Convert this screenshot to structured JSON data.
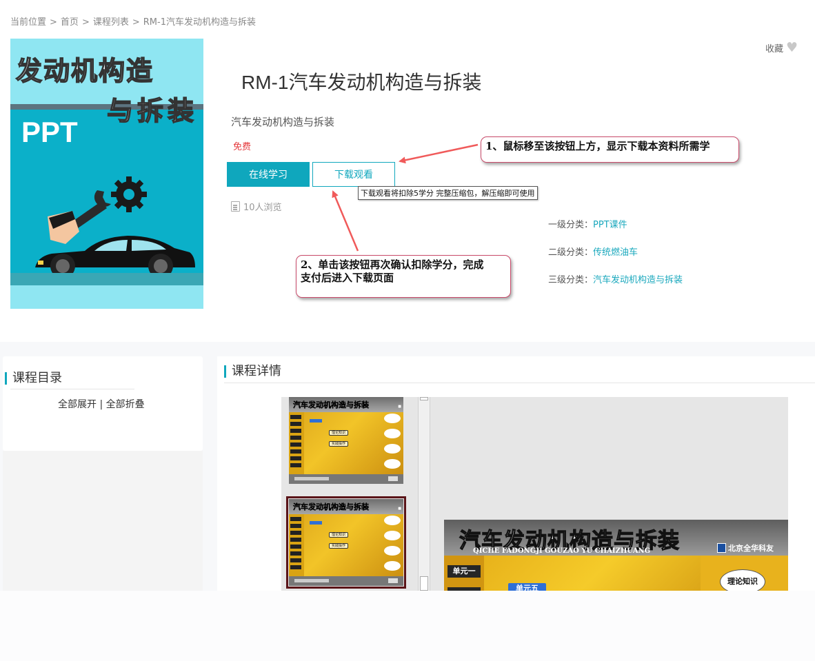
{
  "breadcrumb": {
    "items": [
      "当前位置",
      "首页",
      "课程列表",
      "RM-1汽车发动机构造与拆装"
    ],
    "separator": ">"
  },
  "cover": {
    "line1": "发动机构造",
    "line2": "与拆装",
    "badge": "PPT"
  },
  "course": {
    "title": "RM-1汽车发动机构造与拆装",
    "subtitle": "汽车发动机构造与拆装",
    "price": "免费",
    "learn_button": "在线学习",
    "download_button": "下载观看",
    "download_tooltip": "下载观看将扣除5学分 完整压缩包，解压缩即可使用",
    "views": "10人浏览",
    "favorite": "收藏"
  },
  "categories": [
    {
      "label": "一级分类：",
      "value": "PPT课件"
    },
    {
      "label": "二级分类：",
      "value": "传统燃油车"
    },
    {
      "label": "三级分类：",
      "value": "汽车发动机构造与拆装"
    }
  ],
  "callouts": {
    "first": "1、鼠标移至该按钮上方，显示下载本资料所需学",
    "second_line1": "2、单击该按钮再次确认扣除学分，完成",
    "second_line2": "支付后进入下载页面"
  },
  "toc": {
    "heading": "课程目录",
    "expand_all": "全部展开",
    "divider": "|",
    "collapse_all": "全部折叠"
  },
  "detail": {
    "heading": "课程详情"
  },
  "slide": {
    "title": "汽车发动机构造与拆装",
    "subtitle": "QICHE FADONGJI GOUZAO YU CHAIZHUANG",
    "logo": "北京全华科友",
    "unit1": "单元一",
    "unit5": "单元五",
    "bubble": "理论知识",
    "thumb_title": "汽车发动机构造与拆装",
    "thumb_btn1": "理论知识",
    "thumb_btn2": "实践操作"
  },
  "colors": {
    "accent": "#0fa7bd",
    "price": "#e4393c",
    "callout_border": "#c94a6a",
    "arrow": "#f05a5a"
  }
}
